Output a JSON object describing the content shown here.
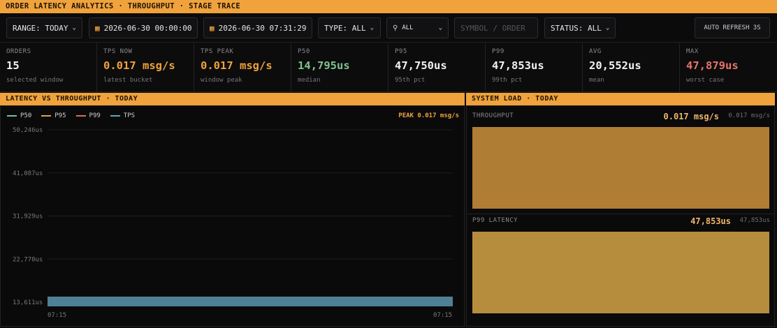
{
  "title": "ORDER LATENCY ANALYTICS · THROUGHPUT · STAGE TRACE",
  "toolbar": {
    "range": "RANGE: TODAY",
    "from": "2026-06-30 00:00:00",
    "to": "2026-06-30 07:31:29",
    "type": "TYPE: ALL",
    "search_scope": "ALL",
    "symbol_placeholder": "SYMBOL / ORDER",
    "status": "STATUS: ALL",
    "auto_refresh": "AUTO REFRESH 3S"
  },
  "stats": [
    {
      "label": "ORDERS",
      "value": "15",
      "sub": "selected window",
      "color": "#f2f2f2"
    },
    {
      "label": "TPS NOW",
      "value": "0.017 msg/s",
      "sub": "latest bucket",
      "color": "#f0a23c"
    },
    {
      "label": "TPS PEAK",
      "value": "0.017 msg/s",
      "sub": "window peak",
      "color": "#f0a23c"
    },
    {
      "label": "P50",
      "value": "14,795us",
      "sub": "median",
      "color": "#7ec48e"
    },
    {
      "label": "P95",
      "value": "47,750us",
      "sub": "95th pct",
      "color": "#f2f2f2"
    },
    {
      "label": "P99",
      "value": "47,853us",
      "sub": "99th pct",
      "color": "#f2f2f2"
    },
    {
      "label": "AVG",
      "value": "20,552us",
      "sub": "mean",
      "color": "#f2f2f2"
    },
    {
      "label": "MAX",
      "value": "47,879us",
      "sub": "worst case",
      "color": "#e8736a"
    }
  ],
  "latency_panel": {
    "title": "LATENCY VS THROUGHPUT · TODAY",
    "peak_label": "PEAK 0.017 msg/s"
  },
  "load_panel": {
    "title": "SYSTEM LOAD · TODAY",
    "throughput_label": "THROUGHPUT",
    "throughput_value": "0.017 msg/s",
    "throughput_max": "0.017 msg/s",
    "p99_label": "P99 LATENCY",
    "p99_value": "47,853us",
    "p99_max": "47,853us",
    "throughput_fill": 1.0,
    "p99_fill": 1.0
  },
  "chart_data": {
    "type": "line",
    "title": "LATENCY VS THROUGHPUT · TODAY",
    "series": [
      {
        "name": "P50",
        "color": "#6fc39a",
        "values": []
      },
      {
        "name": "P95",
        "color": "#e0a04a",
        "values": []
      },
      {
        "name": "P99",
        "color": "#e06a62",
        "values": []
      },
      {
        "name": "TPS",
        "color": "#5aa6c4",
        "values": [
          0.017
        ]
      }
    ],
    "y_ticks": [
      "50,246us",
      "41,087us",
      "31,929us",
      "22,770us",
      "13,611us"
    ],
    "x_ticks": [
      "07:15",
      "07:15"
    ],
    "ylim": [
      13611,
      50246
    ],
    "tps_band_value": 0.017
  }
}
